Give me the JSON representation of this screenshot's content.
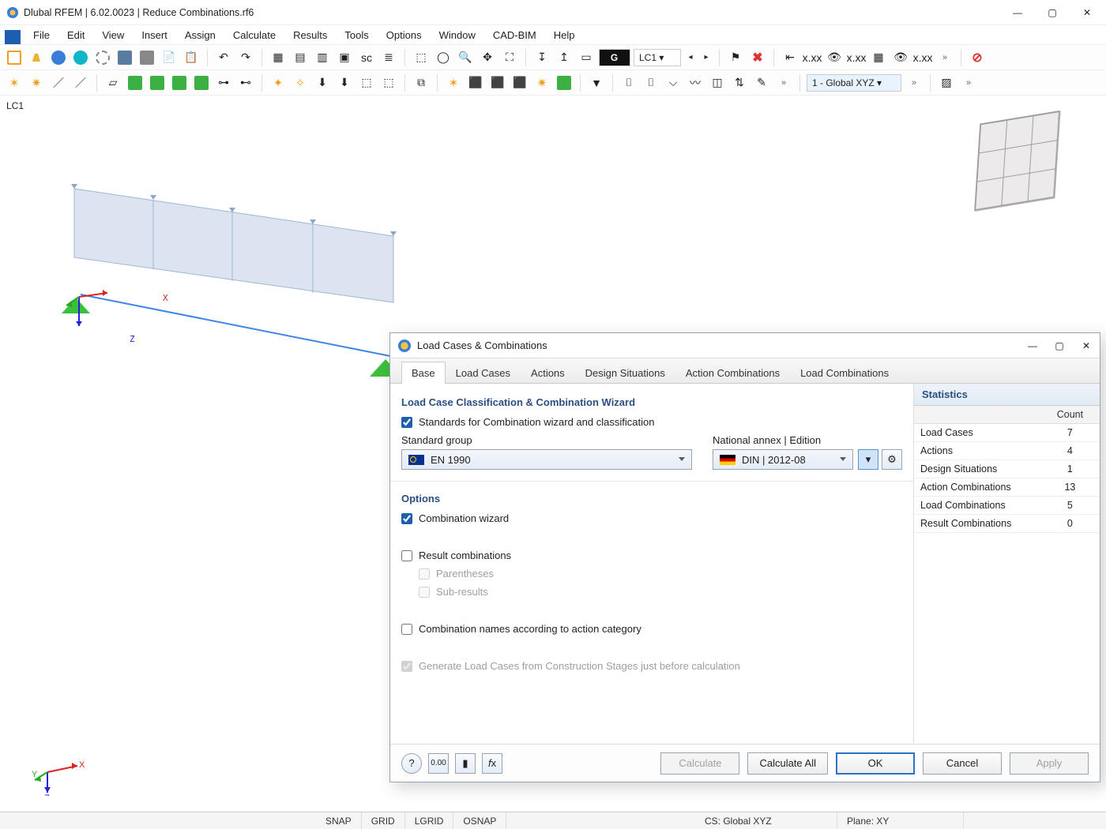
{
  "title": "Dlubal RFEM | 6.02.0023 | Reduce Combinations.rf6",
  "menus": [
    "File",
    "Edit",
    "View",
    "Insert",
    "Assign",
    "Calculate",
    "Results",
    "Tools",
    "Options",
    "Window",
    "CAD-BIM",
    "Help"
  ],
  "toolbar": {
    "lc_badge": "G",
    "lc_value": "LC1",
    "cs_value": "1 - Global XYZ"
  },
  "viewport": {
    "label": "LC1",
    "axis_x": "X",
    "axis_y": "Y",
    "axis_z": "Z"
  },
  "dialog": {
    "title": "Load Cases & Combinations",
    "tabs": [
      "Base",
      "Load Cases",
      "Actions",
      "Design Situations",
      "Action Combinations",
      "Load Combinations"
    ],
    "active_tab": 0,
    "section_wizard": "Load Case Classification & Combination Wizard",
    "chk_standards": "Standards for Combination wizard and classification",
    "label_standard_group": "Standard group",
    "standard_group_value": "EN 1990",
    "label_annex": "National annex | Edition",
    "annex_value": "DIN | 2012-08",
    "section_options": "Options",
    "chk_combo_wizard": "Combination wizard",
    "chk_result_combos": "Result combinations",
    "chk_parentheses": "Parentheses",
    "chk_subresults": "Sub-results",
    "chk_names_by_cat": "Combination names according to action category",
    "chk_gen_from_stages": "Generate Load Cases from Construction Stages just before calculation",
    "stats_title": "Statistics",
    "stats_header": "Count",
    "stats_rows": [
      {
        "k": "Load Cases",
        "v": "7"
      },
      {
        "k": "Actions",
        "v": "4"
      },
      {
        "k": "Design Situations",
        "v": "1"
      },
      {
        "k": "Action Combinations",
        "v": "13"
      },
      {
        "k": "Load Combinations",
        "v": "5"
      },
      {
        "k": "Result Combinations",
        "v": "0"
      }
    ],
    "buttons": {
      "calculate": "Calculate",
      "calculate_all": "Calculate All",
      "ok": "OK",
      "cancel": "Cancel",
      "apply": "Apply"
    }
  },
  "statusbar": {
    "snap": "SNAP",
    "grid": "GRID",
    "lgrid": "LGRID",
    "osnap": "OSNAP",
    "cs": "CS: Global XYZ",
    "plane": "Plane: XY"
  }
}
